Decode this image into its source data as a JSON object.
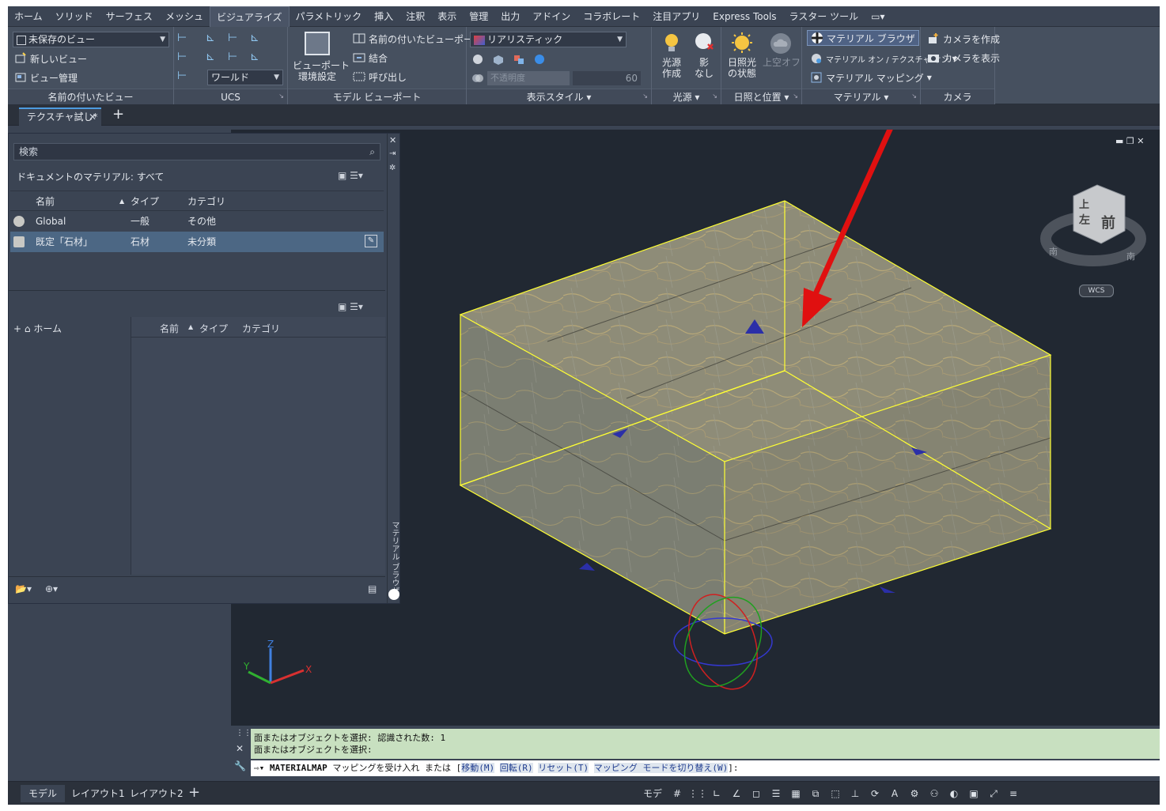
{
  "menu_tabs": [
    "ホーム",
    "ソリッド",
    "サーフェス",
    "メッシュ",
    "ビジュアライズ",
    "パラメトリック",
    "挿入",
    "注釈",
    "表示",
    "管理",
    "出力",
    "アドイン",
    "コラボレート",
    "注目アプリ",
    "Express Tools",
    "ラスター ツール"
  ],
  "active_tab_index": 4,
  "ribbon": {
    "named_views": {
      "title": "名前の付いたビュー",
      "view_combo": "未保存のビュー",
      "new_view": "新しいビュー",
      "view_manager": "ビュー管理"
    },
    "ucs": {
      "title": "UCS",
      "world_combo": "ワールド"
    },
    "model_viewports": {
      "title": "モデル ビューポート",
      "viewport_config": "ビューポート\n環境設定",
      "named_viewports": "名前の付いたビューポート",
      "join": "結合",
      "restore": "呼び出し"
    },
    "visual_styles": {
      "title": "表示スタイル",
      "style_combo": "リアリスティック",
      "opacity_label": "不透明度",
      "opacity_value": "60"
    },
    "lights": {
      "title": "光源",
      "create_light": "光源\n作成",
      "shadows": "影\nなし"
    },
    "sun": {
      "title": "日照と位置",
      "sun_status": "日照光\nの状態",
      "sky_off": "上空オフ"
    },
    "materials": {
      "title": "マテリアル",
      "material_browser": "マテリアル ブラウザ",
      "materials_on": "マテリアル オン / テクスチャ オン",
      "material_mapping": "マテリアル マッピング"
    },
    "camera": {
      "title": "カメラ",
      "create_camera": "カメラを作成",
      "show_camera": "カメラを表示"
    }
  },
  "document_tab": "テクスチャ試し*",
  "palette": {
    "search_placeholder": "検索",
    "filter_label": "ドキュメントのマテリアル: すべて",
    "columns": {
      "name": "名前",
      "type": "タイプ",
      "category": "カテゴリ"
    },
    "materials": [
      {
        "name": "Global",
        "type": "一般",
        "category": "その他"
      },
      {
        "name": "既定「石材」",
        "type": "石材",
        "category": "未分類"
      }
    ],
    "library_home": "ホーム",
    "side_title": "マテリアル ブラウザ"
  },
  "viewcube": {
    "top": "上",
    "left": "左",
    "front": "前",
    "wcs": "WCS",
    "south_left": "南",
    "south_right": "南"
  },
  "axes": {
    "x": "X",
    "y": "Y",
    "z": "Z"
  },
  "command": {
    "history": [
      "面またはオブジェクトを選択: 認識された数: 1",
      "面またはオブジェクトを選択:"
    ],
    "prompt_cmd": "MATERIALMAP",
    "prompt_text": "マッピングを受け入れ または [",
    "options": [
      "移動(M)",
      "回転(R)",
      "リセット(T)",
      "マッピング モードを切り替え(W)"
    ],
    "prompt_end": "]:"
  },
  "status": {
    "layouts": [
      "モデル",
      "レイアウト1",
      "レイアウト2"
    ],
    "model_label": "モデル"
  },
  "colors": {
    "accent": "#4d9be0",
    "selection": "#ffff33",
    "arrow": "#e01010"
  }
}
